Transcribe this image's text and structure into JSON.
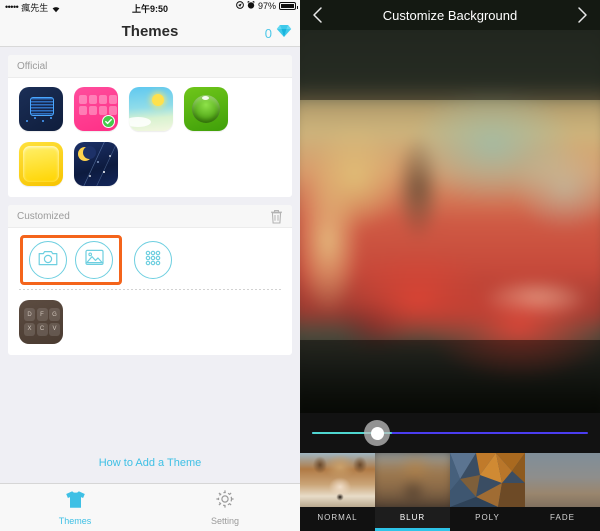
{
  "left_phone": {
    "status_bar": {
      "signal_dots": "•••••",
      "carrier": "瘋先生",
      "wifi_icon": "wifi-icon",
      "time": "上午9:50",
      "location_icon": "location-arrow-icon",
      "alarm_icon": "alarm-clock-icon",
      "battery_percent": "97%",
      "battery_icon": "battery-icon"
    },
    "navbar": {
      "title": "Themes",
      "gem_count": "0",
      "gem_icon": "diamond-icon"
    },
    "official_section": {
      "header": "Official",
      "themes": [
        {
          "name": "circuit-chip-theme"
        },
        {
          "name": "pink-keyboard-theme",
          "selected": true
        },
        {
          "name": "sky-sunrise-theme"
        },
        {
          "name": "green-orb-theme"
        },
        {
          "name": "yellow-glossy-theme"
        },
        {
          "name": "night-moon-theme"
        }
      ]
    },
    "customized_section": {
      "header": "Customized",
      "trash_icon": "trash-icon",
      "actions": [
        {
          "name": "camera-button",
          "icon": "camera-icon",
          "highlighted": true
        },
        {
          "name": "photo-library-button",
          "icon": "image-icon",
          "highlighted": true
        },
        {
          "name": "pattern-button",
          "icon": "dot-grid-icon",
          "highlighted": false
        }
      ],
      "saved_themes": [
        {
          "name": "brown-keyboard-theme",
          "keys": [
            "D",
            "F",
            "G",
            "X",
            "C",
            "V"
          ]
        }
      ]
    },
    "how_to_link": "How to Add a Theme",
    "tabbar": [
      {
        "name": "tab-themes",
        "label": "Themes",
        "icon": "tshirt-icon",
        "active": true
      },
      {
        "name": "tab-setting",
        "label": "Setting",
        "icon": "gear-icon",
        "active": false
      }
    ]
  },
  "right_phone": {
    "navbar": {
      "title": "Customize Background",
      "back_icon": "chevron-left-icon",
      "forward_icon": "chevron-right-icon"
    },
    "preview": {
      "name": "background-preview",
      "description": "blurred red vintage car photo"
    },
    "slider": {
      "name": "blur-intensity-slider",
      "value_percent": 29
    },
    "filters": [
      {
        "name": "filter-normal",
        "label": "NORMAL",
        "selected": false
      },
      {
        "name": "filter-blur",
        "label": "BLUR",
        "selected": true
      },
      {
        "name": "filter-poly",
        "label": "POLY",
        "selected": false
      },
      {
        "name": "filter-fade",
        "label": "FADE",
        "selected": false
      }
    ]
  },
  "colors": {
    "accent_cyan": "#3fc0e5",
    "selection_orange": "#f4641b",
    "slider_left": "#4fd6d0",
    "slider_right": "#4b3df0",
    "filter_underline": "#2ec4e8"
  }
}
